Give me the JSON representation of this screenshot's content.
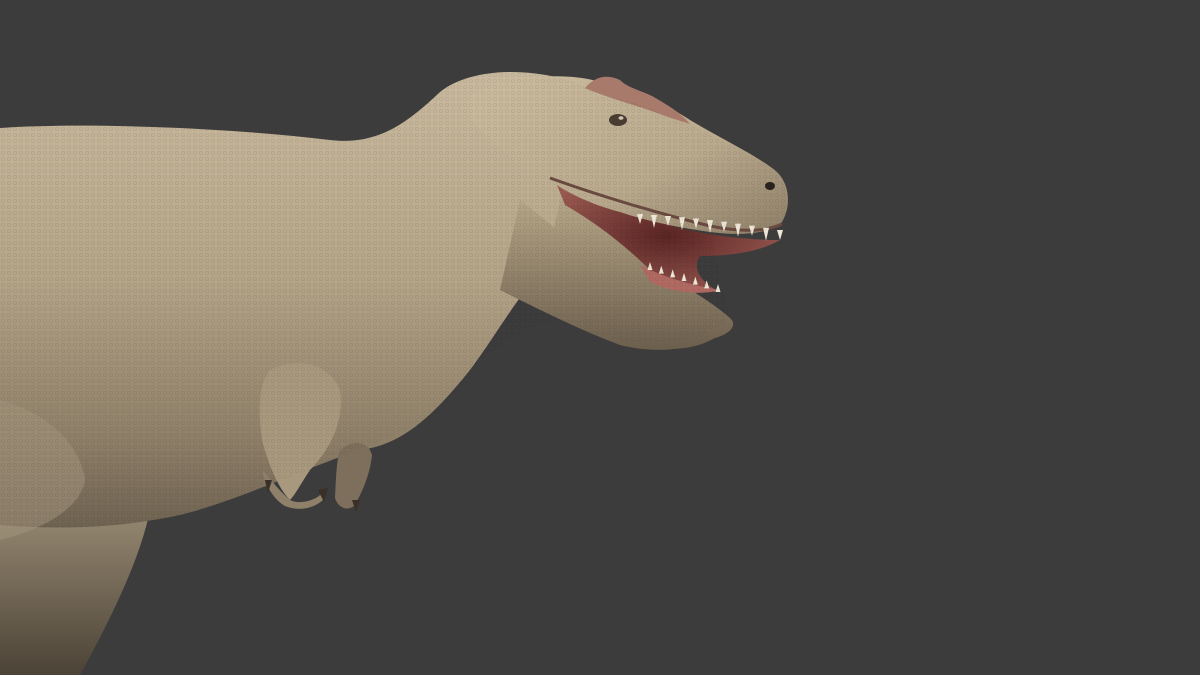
{
  "scene": {
    "subject": "dinosaur-render",
    "colors": {
      "background": "#3c3c3c",
      "skin_light": "#c7b79c",
      "skin_mid": "#a8987d",
      "skin_shadow": "#7d6f5b",
      "skin_dark": "#5e5244",
      "mouth": "#8a4a46",
      "mouth_dark": "#4a1f1f",
      "teeth": "#eee6d6",
      "nostril": "#2a221c",
      "crest_accent": "#a06a60"
    }
  }
}
